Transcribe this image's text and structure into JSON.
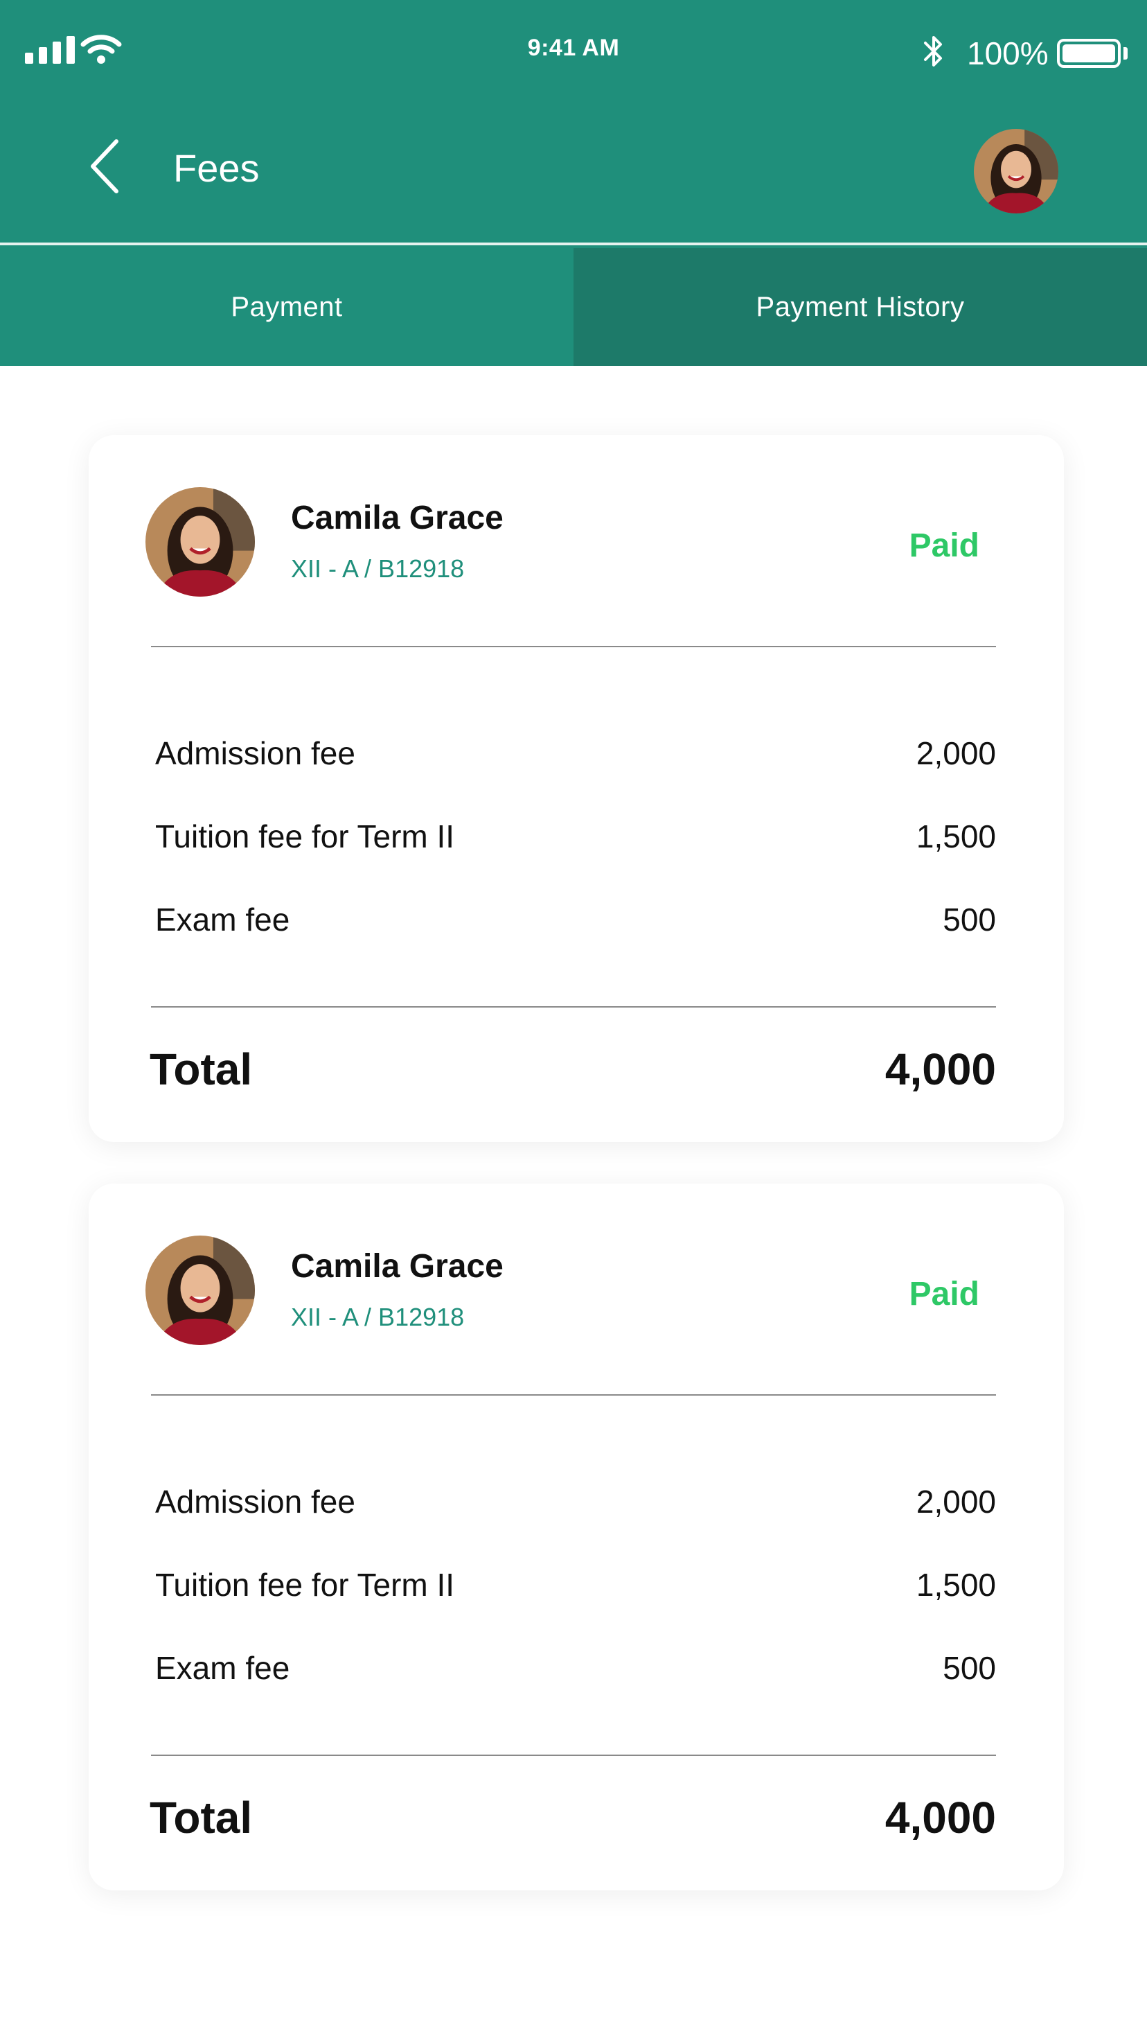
{
  "status_bar": {
    "time": "9:41 AM",
    "battery_percent": "100%",
    "battery_level": 1.0,
    "icons": [
      "signal-icon",
      "wifi-icon",
      "bluetooth-icon",
      "battery-icon"
    ]
  },
  "header": {
    "title": "Fees",
    "back_icon": "chevron-left-icon",
    "background_color": "#1f8f7b"
  },
  "tabs": [
    {
      "label": "Payment",
      "selected": true
    },
    {
      "label": "Payment History",
      "selected": false
    }
  ],
  "colors": {
    "accent": "#1f8f7b",
    "paid_status": "#2ec866",
    "tab_alt": "#1d7a69"
  },
  "payments": [
    {
      "student_name": "Camila Grace",
      "class_id": "XII - A / B12918",
      "status": "Paid",
      "items": [
        {
          "label": "Admission fee",
          "amount": "2,000"
        },
        {
          "label": "Tuition fee for Term II",
          "amount": "1,500"
        },
        {
          "label": "Exam fee",
          "amount": "500"
        }
      ],
      "total_label": "Total",
      "total_amount": "4,000"
    },
    {
      "student_name": "Camila Grace",
      "class_id": "XII - A / B12918",
      "status": "Paid",
      "items": [
        {
          "label": "Admission fee",
          "amount": "2,000"
        },
        {
          "label": "Tuition fee for Term II",
          "amount": "1,500"
        },
        {
          "label": "Exam fee",
          "amount": "500"
        }
      ],
      "total_label": "Total",
      "total_amount": "4,000"
    }
  ]
}
